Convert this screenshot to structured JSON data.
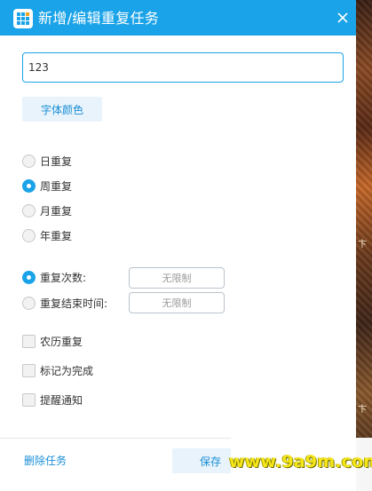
{
  "window": {
    "title": "新增/编辑重复任务",
    "accent_color": "#1aa3e8",
    "app_icon": "app-grid-icon",
    "close_icon": "close-icon"
  },
  "task_input": {
    "value": "123"
  },
  "font_color_button": {
    "label": "字体颜色"
  },
  "repeat_options": [
    {
      "label": "日重复",
      "selected": false
    },
    {
      "label": "周重复",
      "selected": true
    },
    {
      "label": "月重复",
      "selected": false
    },
    {
      "label": "年重复",
      "selected": false
    }
  ],
  "end_condition": {
    "count": {
      "label": "重复次数:",
      "selected": true,
      "value": "无限制"
    },
    "end_time": {
      "label": "重复结束时间:",
      "selected": false,
      "value": "无限制"
    }
  },
  "checkboxes": [
    {
      "label": "农历重复",
      "checked": false
    },
    {
      "label": "标记为完成",
      "checked": false
    },
    {
      "label": "提醒通知",
      "checked": false
    }
  ],
  "footer": {
    "delete_label": "删除任务",
    "save_label": "保存"
  },
  "watermark": "www.9a9m.com"
}
